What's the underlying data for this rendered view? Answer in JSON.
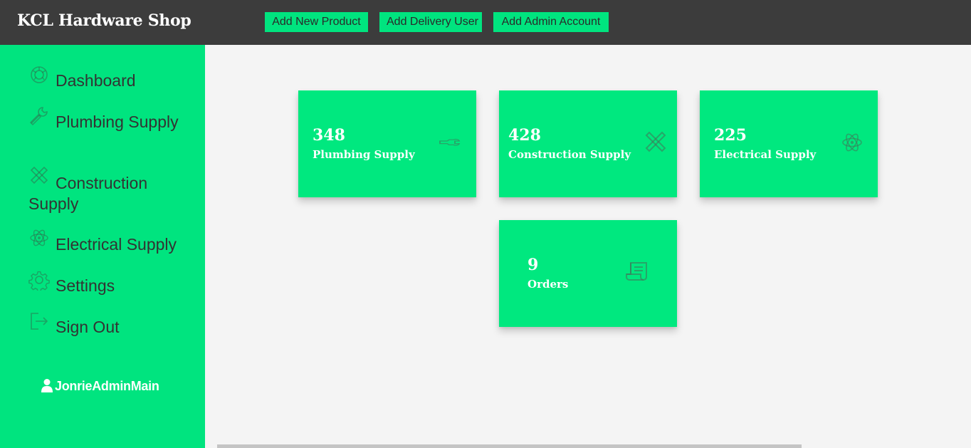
{
  "header": {
    "brand": "KCL Hardware Shop",
    "buttons": {
      "add_product": "Add New Product",
      "add_delivery": "Add Delivery User",
      "add_admin": "Add Admin Account"
    }
  },
  "sidebar": {
    "items": [
      {
        "label": "Dashboard",
        "icon": "dashboard-icon"
      },
      {
        "label": "Plumbing Supply",
        "icon": "wrench-icon"
      },
      {
        "label": "Construction Supply",
        "icon": "tools-icon"
      },
      {
        "label": "Electrical Supply",
        "icon": "atom-icon"
      },
      {
        "label": "Settings",
        "icon": "gear-icon"
      },
      {
        "label": "Sign Out",
        "icon": "sign-out-icon"
      }
    ],
    "user": "JonrieAdminMain"
  },
  "cards": [
    {
      "value": "348",
      "label": "Plumbing Supply",
      "icon": "wrench-icon"
    },
    {
      "value": "428",
      "label": "Construction Supply",
      "icon": "tools-icon"
    },
    {
      "value": "225",
      "label": "Electrical Supply",
      "icon": "atom-icon"
    },
    {
      "value": "9",
      "label": "Orders",
      "icon": "receipt-icon"
    }
  ],
  "colors": {
    "accent": "#00e47f",
    "topbar": "#3c3c3c",
    "background": "#f4f4f4"
  }
}
